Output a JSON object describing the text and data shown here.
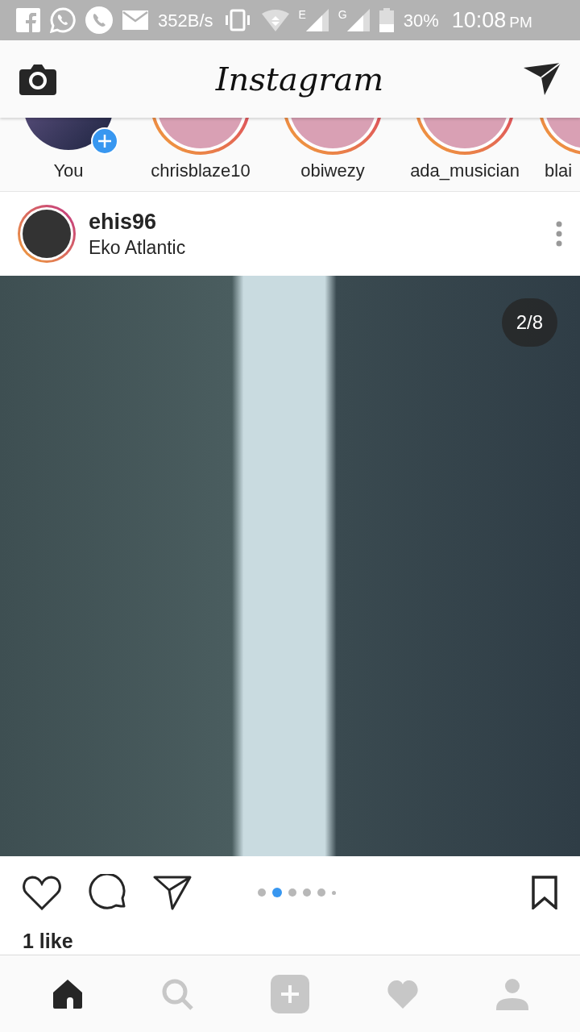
{
  "status_bar": {
    "speed": "352B/s",
    "network_1": "E",
    "network_2": "G",
    "battery": "30%",
    "time": "10:08",
    "ampm": "PM"
  },
  "header": {
    "title": "Instagram"
  },
  "stories": [
    {
      "name": "You",
      "kind": "own"
    },
    {
      "name": "chrisblaze10",
      "kind": "ring"
    },
    {
      "name": "obiwezy",
      "kind": "ring"
    },
    {
      "name": "ada_musician",
      "kind": "ring"
    },
    {
      "name": "blai",
      "kind": "ring"
    }
  ],
  "post": {
    "username": "ehis96",
    "location": "Eko Atlantic",
    "counter": "2/8",
    "dots": [
      {
        "selected": false,
        "kind": "full"
      },
      {
        "selected": true,
        "kind": "full"
      },
      {
        "selected": false,
        "kind": "full"
      },
      {
        "selected": false,
        "kind": "full"
      },
      {
        "selected": false,
        "kind": "full"
      },
      {
        "selected": false,
        "kind": "small"
      }
    ],
    "likes": "1 like"
  },
  "nav": [
    {
      "kind": "home",
      "selected": true
    },
    {
      "kind": "search",
      "selected": false
    },
    {
      "kind": "add",
      "selected": false
    },
    {
      "kind": "activity",
      "selected": false
    },
    {
      "kind": "profile",
      "selected": false
    }
  ]
}
